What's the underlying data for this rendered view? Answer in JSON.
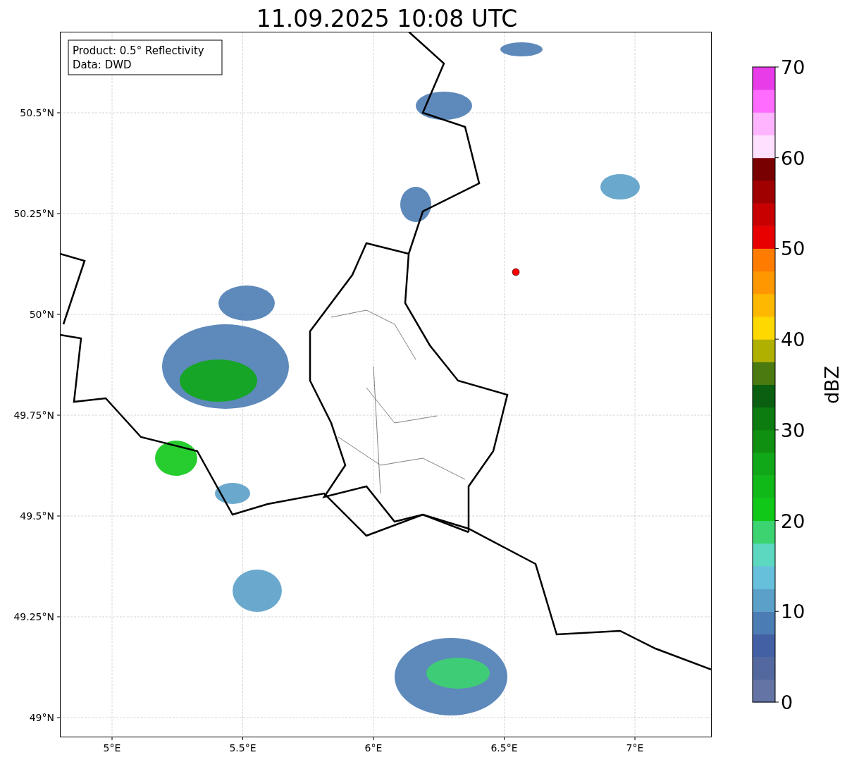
{
  "title": "11.09.2025 10:08 UTC",
  "info_box": {
    "lines": [
      "Product: 0.5° Reflectivity",
      "Data: DWD"
    ]
  },
  "y_axis": {
    "ticks": [
      "50.5°N",
      "50.25°N",
      "50°N",
      "49.75°N",
      "49.5°N",
      "49.25°N",
      "49°N"
    ]
  },
  "x_axis": {
    "ticks": [
      "5°E",
      "5.5°E",
      "6°E",
      "6.5°E",
      "7°E"
    ]
  },
  "colorbar": {
    "label": "dBZ",
    "ticks": [
      "70",
      "60",
      "50",
      "40",
      "30",
      "20",
      "10",
      "0"
    ],
    "segments": [
      {
        "color": "#6474a4"
      },
      {
        "color": "#5468a0"
      },
      {
        "color": "#4460a4"
      },
      {
        "color": "#4c7cb4"
      },
      {
        "color": "#5aa0c8"
      },
      {
        "color": "#66c0dc"
      },
      {
        "color": "#5cd8c0"
      },
      {
        "color": "#3cd470"
      },
      {
        "color": "#10c818"
      },
      {
        "color": "#10b818"
      },
      {
        "color": "#10a818"
      },
      {
        "color": "#109010"
      },
      {
        "color": "#0c7c10"
      },
      {
        "color": "#0a6010"
      },
      {
        "color": "#4a7a10"
      },
      {
        "color": "#b0b000"
      },
      {
        "color": "#ffd800"
      },
      {
        "color": "#ffb800"
      },
      {
        "color": "#ff9800"
      },
      {
        "color": "#ff7c00"
      },
      {
        "color": "#e80000"
      },
      {
        "color": "#c80000"
      },
      {
        "color": "#a00000"
      },
      {
        "color": "#780000"
      },
      {
        "color": "#ffe0ff"
      },
      {
        "color": "#ffb4ff"
      },
      {
        "color": "#ff6cff"
      },
      {
        "color": "#e83ce8"
      }
    ]
  }
}
